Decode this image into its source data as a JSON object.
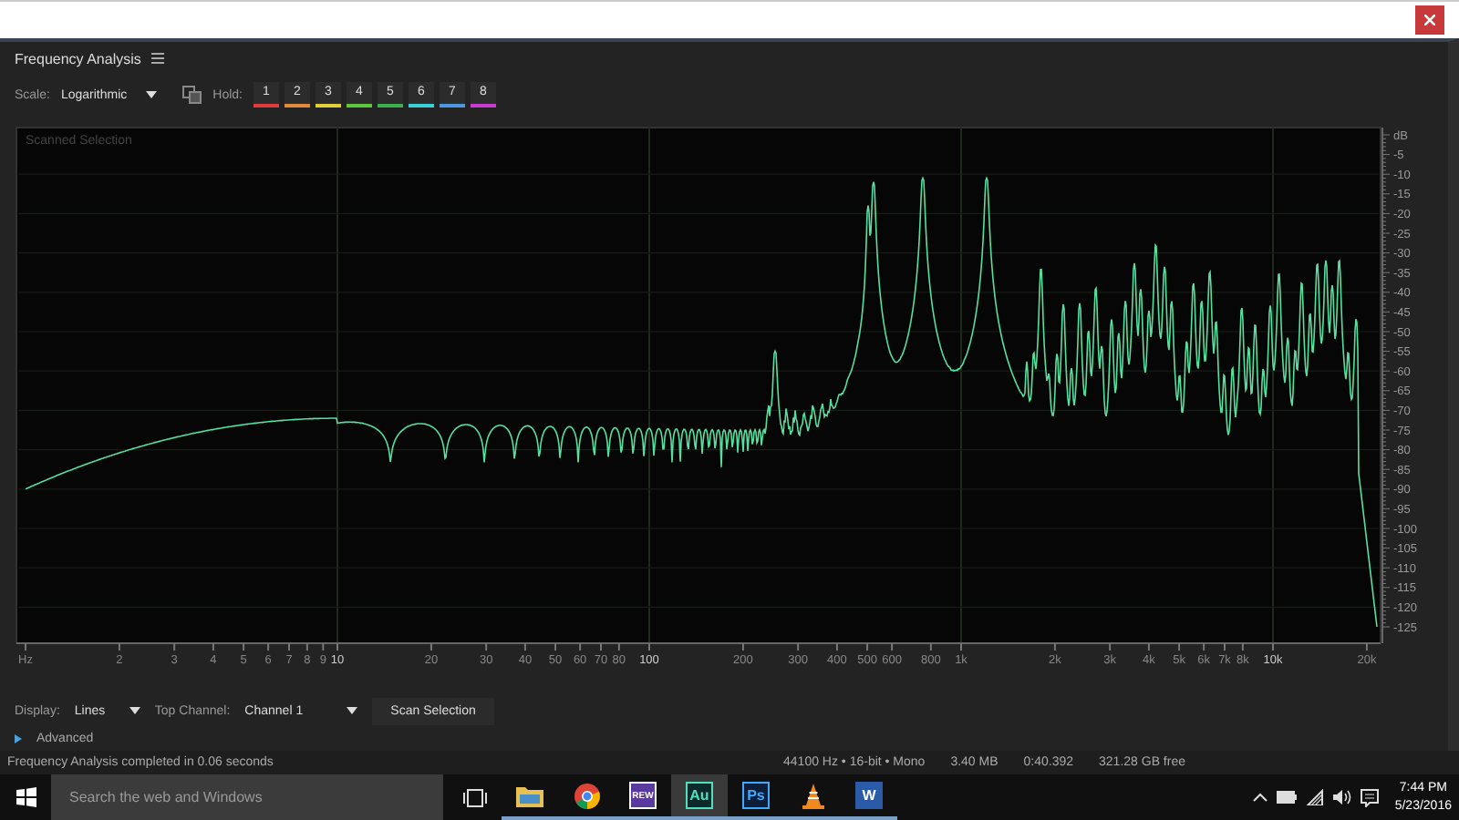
{
  "panel": {
    "title": "Frequency Analysis"
  },
  "toolbar": {
    "scale_label": "Scale:",
    "scale_value": "Logarithmic",
    "hold_label": "Hold:",
    "hold_buttons": [
      {
        "label": "1",
        "color": "#e03c3c"
      },
      {
        "label": "2",
        "color": "#e08a3a"
      },
      {
        "label": "3",
        "color": "#e0d03a"
      },
      {
        "label": "4",
        "color": "#5cc83a"
      },
      {
        "label": "5",
        "color": "#3cb04a"
      },
      {
        "label": "6",
        "color": "#3ad0d8"
      },
      {
        "label": "7",
        "color": "#4a98e0"
      },
      {
        "label": "8",
        "color": "#c83ad0"
      }
    ]
  },
  "plot": {
    "caption": "Scanned Selection",
    "x_labels": [
      "Hz",
      "2",
      "3",
      "4",
      "5",
      "6",
      "7",
      "8",
      "9",
      "10",
      "20",
      "30",
      "40",
      "50",
      "60",
      "70",
      "80",
      "100",
      "200",
      "300",
      "400",
      "500",
      "600",
      "800",
      "1k",
      "2k",
      "3k",
      "4k",
      "5k",
      "6k",
      "7k",
      "8k",
      "10k",
      "20k"
    ],
    "y_labels": [
      "dB",
      "-5",
      "-10",
      "-15",
      "-20",
      "-25",
      "-30",
      "-35",
      "-40",
      "-45",
      "-50",
      "-55",
      "-60",
      "-65",
      "-70",
      "-75",
      "-80",
      "-85",
      "-90",
      "-95",
      "-100",
      "-105",
      "-110",
      "-115",
      "-120",
      "-125"
    ]
  },
  "controls": {
    "display_label": "Display:",
    "display_value": "Lines",
    "channel_label": "Top Channel:",
    "channel_value": "Channel 1",
    "scan_button": "Scan Selection",
    "advanced": {
      "label": "Advanced",
      "expanded": false
    }
  },
  "status_bar": {
    "message": "Frequency Analysis completed in 0.06 seconds",
    "format": "44100 Hz • 16-bit • Mono",
    "size": "3.40 MB",
    "duration": "0:40.392",
    "free_space": "321.28 GB free"
  },
  "taskbar": {
    "search_placeholder": "Search the web and Windows",
    "apps": [
      {
        "kind": "folder",
        "selected": false
      },
      {
        "kind": "chrome",
        "selected": false
      },
      {
        "kind": "rew",
        "label": "REW",
        "selected": false
      },
      {
        "kind": "audition",
        "label": "Au",
        "selected": true
      },
      {
        "kind": "photoshop",
        "label": "Ps",
        "selected": false
      },
      {
        "kind": "vlc",
        "selected": false
      },
      {
        "kind": "word",
        "label": "W",
        "selected": false
      }
    ],
    "time": "7:44 PM",
    "date": "5/23/2016"
  }
}
